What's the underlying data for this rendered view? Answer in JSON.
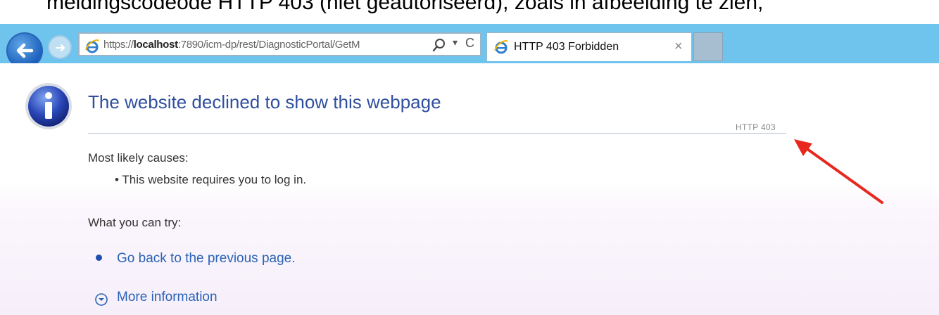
{
  "caption": {
    "text": "meldingscodeode HTTP 403 (niet geautoriseerd), zoals in afbeelding te zien,"
  },
  "browser": {
    "url_prefix": "https://",
    "url_host": "localhost",
    "url_rest": ":7890/icm-dp/rest/DiagnosticPortal/GetM",
    "tab_title": "HTTP 403 Forbidden",
    "tab_close": "×",
    "dropdown": "▾",
    "refresh": "C"
  },
  "page": {
    "heading": "The website declined to show this webpage",
    "status_code": "HTTP 403",
    "causes_heading": "Most likely causes:",
    "causes": [
      "This website requires you to log in."
    ],
    "try_heading": "What you can try:",
    "link_back": "Go back to the previous page.",
    "link_more": "More information"
  },
  "colors": {
    "toolbar": "#6ec4ec",
    "heading": "#2f4f9e",
    "link": "#2a63b6",
    "annotation_arrow": "#e8281f"
  },
  "icons": {
    "back": "back-arrow-icon",
    "forward": "forward-arrow-icon",
    "page": "ie-logo-icon",
    "search": "search-icon",
    "info": "info-icon",
    "more": "chevron-circle-icon",
    "annotation": "red-arrow-icon"
  }
}
